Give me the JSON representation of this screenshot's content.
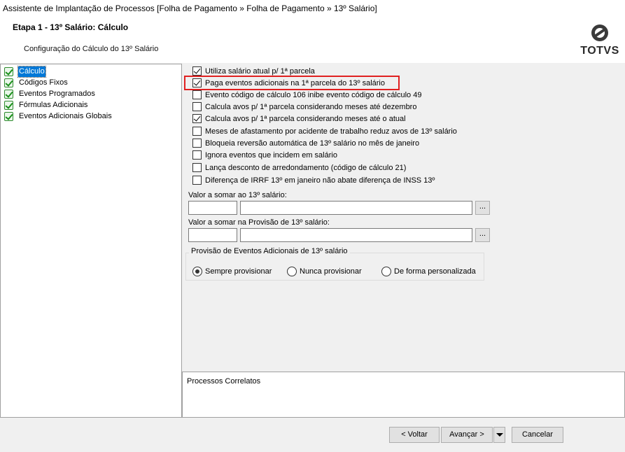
{
  "window": {
    "title": "Assistente de Implantação de Processos [Folha de Pagamento » Folha de Pagamento » 13º Salário]"
  },
  "header": {
    "step_title": "Etapa 1 - 13º Salário: Cálculo",
    "subtitle": "Configuração do Cálculo do 13º Salário",
    "logo_text": "TOTVS"
  },
  "sidebar": {
    "items": [
      {
        "label": "Cálculo",
        "selected": true
      },
      {
        "label": "Códigos Fixos"
      },
      {
        "label": "Eventos Programados"
      },
      {
        "label": "Fórmulas Adicionais"
      },
      {
        "label": "Eventos Adicionais Globais"
      }
    ]
  },
  "options": [
    {
      "label": "Utiliza salário atual p/ 1ª parcela",
      "checked": true
    },
    {
      "label": "Paga eventos adicionais na 1ª parcela do 13º salário",
      "checked": true
    },
    {
      "label": "Evento código de cálculo 106 inibe evento código de cálculo 49",
      "checked": false
    },
    {
      "label": "Calcula avos p/ 1ª parcela considerando meses até dezembro",
      "checked": false
    },
    {
      "label": "Calcula avos p/ 1ª parcela considerando meses até o atual",
      "checked": true
    },
    {
      "label": "Meses de afastamento por acidente de trabalho reduz avos de 13º salário",
      "checked": false
    },
    {
      "label": "Bloqueia reversão automática de 13º salário no mês de janeiro",
      "checked": false
    },
    {
      "label": "Ignora eventos que incidem em salário",
      "checked": false
    },
    {
      "label": "Lança desconto de arredondamento (código de cálculo 21)",
      "checked": false
    },
    {
      "label": "Diferença de IRRF 13º em janeiro não abate diferença de INSS 13º",
      "checked": false
    }
  ],
  "fields": {
    "valor_somar_label": "Valor a somar ao 13º salário:",
    "valor_somar_code": "",
    "valor_somar_desc": "",
    "valor_provisao_label": "Valor a somar na Provisão de 13º salário:",
    "valor_provisao_code": "",
    "valor_provisao_desc": "",
    "lookup_button": "..."
  },
  "provisao": {
    "title": "Provisão de Eventos Adicionais de 13º salário",
    "options": [
      {
        "label": "Sempre provisionar",
        "selected": true
      },
      {
        "label": "Nunca provisionar",
        "selected": false
      },
      {
        "label": "De forma personalizada",
        "selected": false
      }
    ]
  },
  "related": {
    "title": "Processos Correlatos"
  },
  "footer": {
    "back": "< Voltar",
    "next": "Avançar >",
    "cancel": "Cancelar"
  }
}
